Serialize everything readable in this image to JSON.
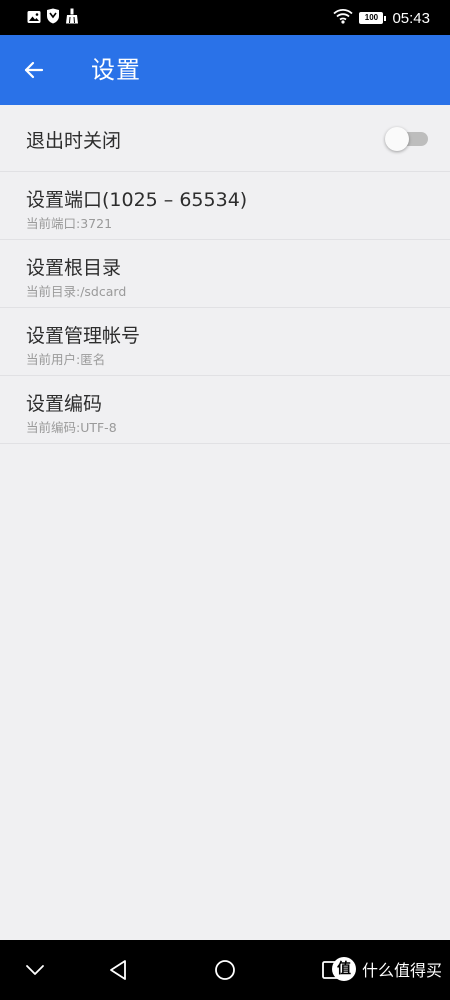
{
  "status_bar": {
    "time": "05:43",
    "battery": "100",
    "icons": [
      "image-icon",
      "shield-icon",
      "broom-icon",
      "wifi-icon",
      "battery-icon"
    ]
  },
  "app_bar": {
    "title": "设置",
    "back_icon": "arrow-back-icon",
    "color": "#2a72e8"
  },
  "settings": {
    "exit_close": {
      "label": "退出时关闭",
      "enabled": false
    },
    "port": {
      "label": "设置端口(1025 – 65534)",
      "subtitle": "当前端口:3721"
    },
    "root_dir": {
      "label": "设置根目录",
      "subtitle": "当前目录:/sdcard"
    },
    "admin_account": {
      "label": "设置管理帐号",
      "subtitle": "当前用户:匿名"
    },
    "encoding": {
      "label": "设置编码",
      "subtitle": "当前编码:UTF-8"
    }
  },
  "nav_bar": {
    "buttons": [
      "collapse-down-icon",
      "back-triangle-icon",
      "home-circle-icon",
      "recents-square-icon"
    ]
  },
  "watermark": {
    "logo": "值",
    "text": "什么值得买"
  }
}
